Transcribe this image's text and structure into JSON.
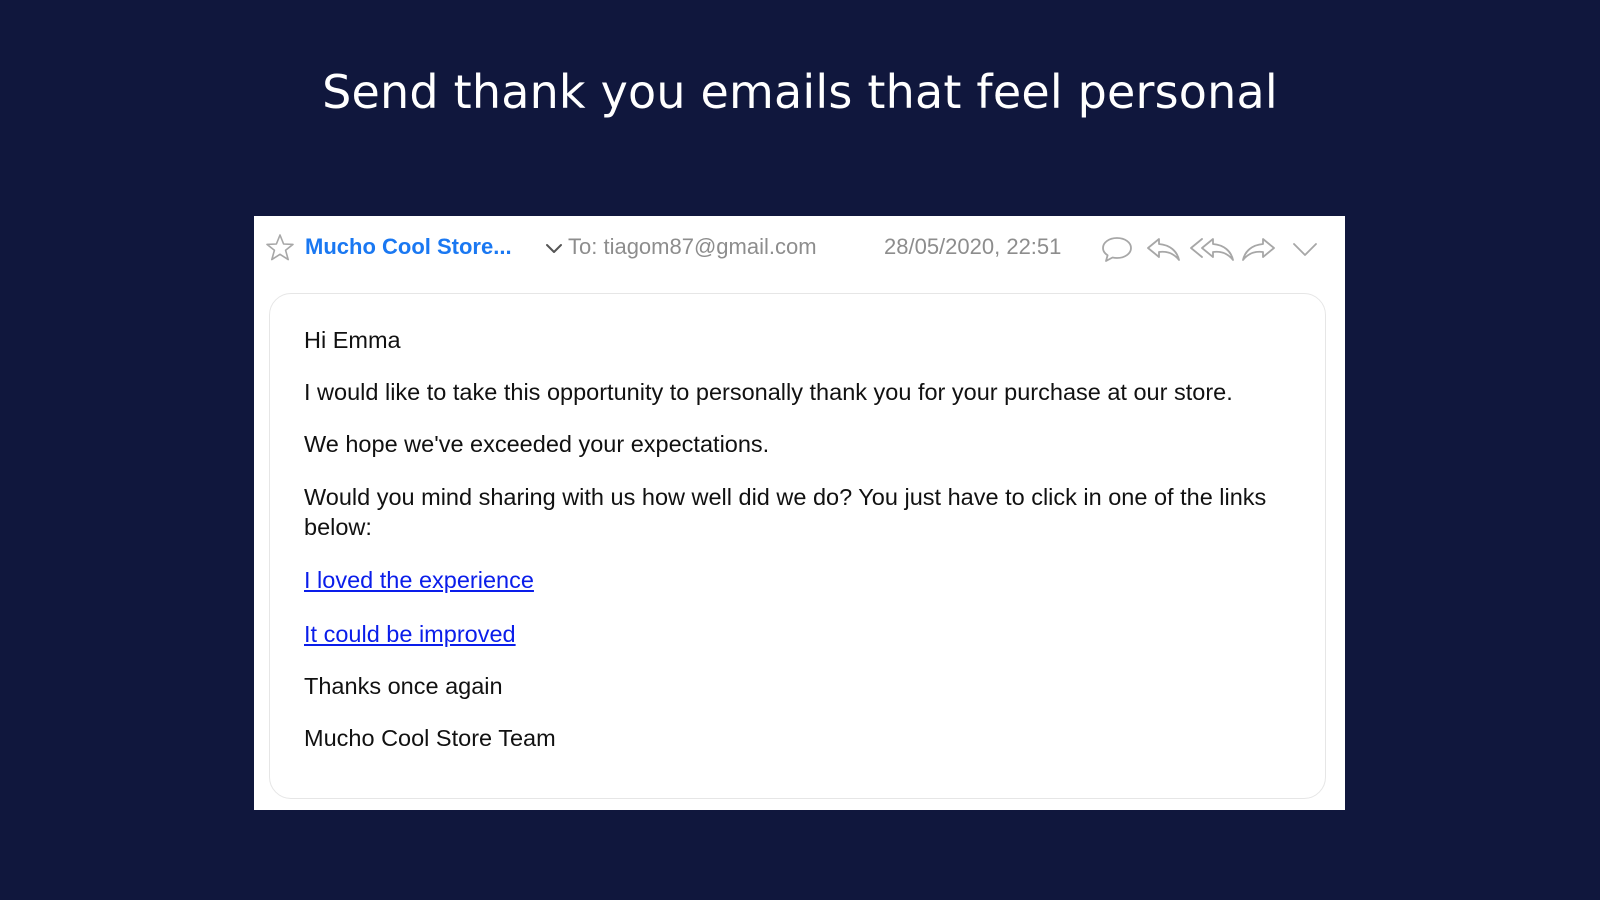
{
  "headline": "Send thank you emails that feel personal",
  "email": {
    "header": {
      "star_icon": "star-icon",
      "sender": "Mucho Cool Store...",
      "expand_icon": "chevron-down-icon",
      "to": "To: tiagom87@gmail.com",
      "date": "28/05/2020, 22:51",
      "actions": [
        {
          "name": "comment",
          "icon": "speech-bubble-icon"
        },
        {
          "name": "reply",
          "icon": "reply-icon"
        },
        {
          "name": "reply-all",
          "icon": "reply-all-icon"
        },
        {
          "name": "forward",
          "icon": "forward-icon"
        },
        {
          "name": "more",
          "icon": "chevron-down-icon"
        }
      ]
    },
    "body": {
      "greeting": "Hi Emma",
      "line1": "I would like to take this opportunity to personally thank you for your purchase at our store.",
      "line2": "We hope we've exceeded your expectations.",
      "line3": "Would you mind sharing with us how well did we do? You just have to click in one of the links below:",
      "link_positive": "I loved the experience",
      "link_negative": "It could be improved",
      "closing": "Thanks once again",
      "signature": "Mucho Cool Store Team"
    }
  },
  "colors": {
    "background": "#10173d",
    "sender": "#1a78f2",
    "link": "#0a1dea",
    "meta_text": "#8d8d8d"
  }
}
